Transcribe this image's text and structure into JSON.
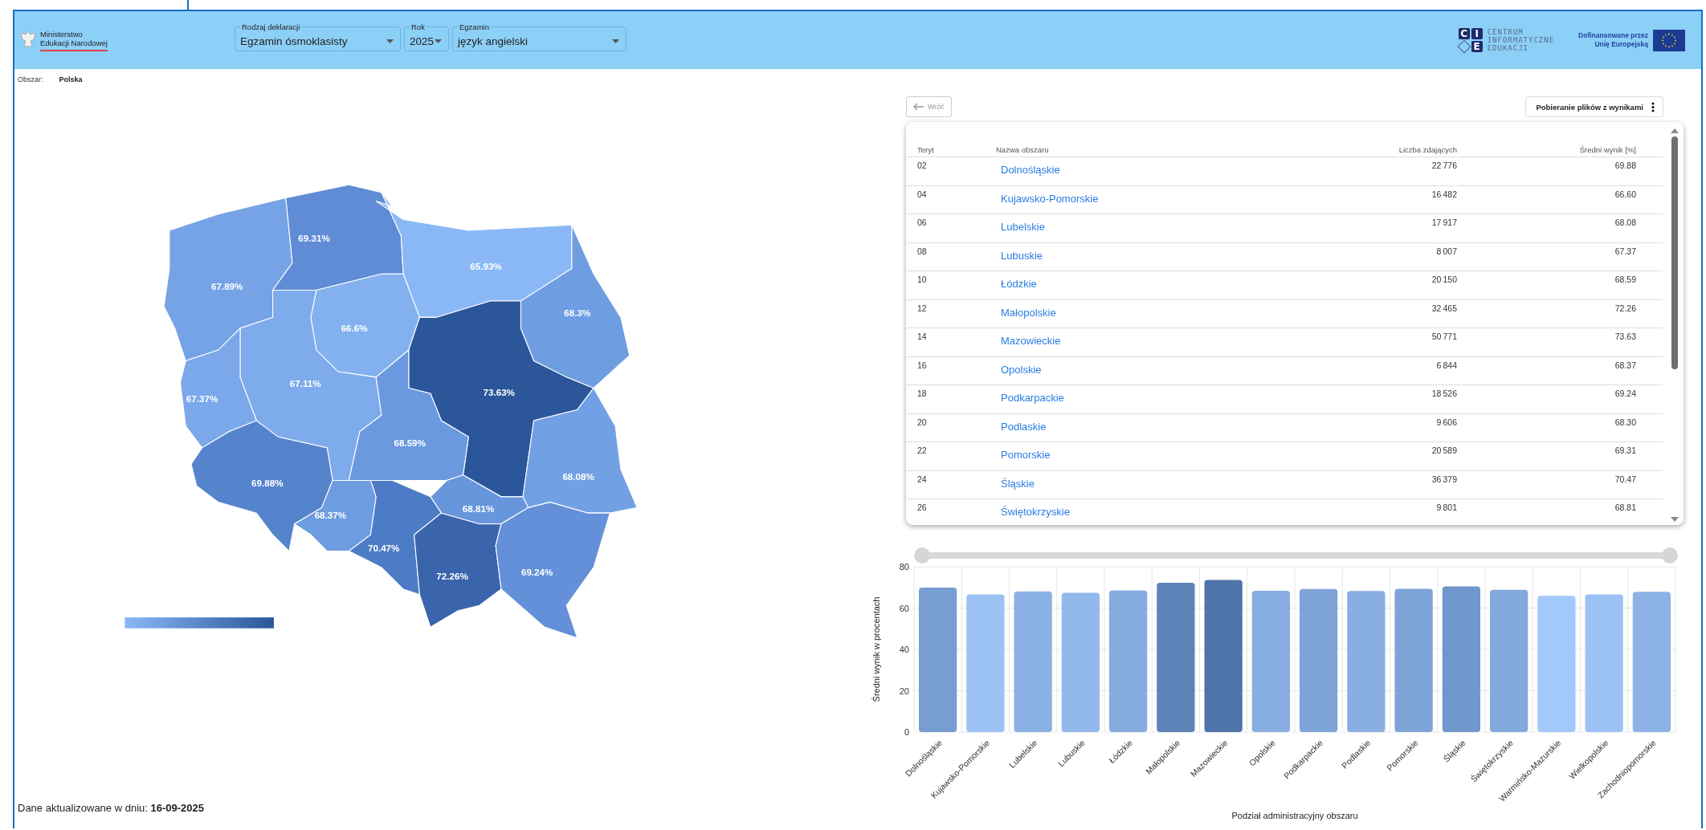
{
  "header": {
    "ministry_name": [
      "Ministerstwo",
      "Edukacji Narodowej"
    ],
    "filters": [
      {
        "label": "Rodzaj deklaracji",
        "value": "Egzamin ósmoklasisty"
      },
      {
        "label": "Rok",
        "value": "2025"
      },
      {
        "label": "Egzamin",
        "value": "język angielski"
      }
    ],
    "cie_logo": {
      "letters": [
        "C",
        "I",
        "E"
      ],
      "lines": [
        "CENTRUM",
        "INFORMATYCZNE",
        "EDUKACJI"
      ]
    },
    "eu_funding": [
      "Dofinansowane przez",
      "Unię Europejską"
    ]
  },
  "area": {
    "label": "Obszar:",
    "value": "Polska"
  },
  "map": {
    "regions": [
      {
        "label": "67.89%",
        "color": "#75a3e6"
      },
      {
        "label": "69.31%",
        "color": "#5f8cd5"
      },
      {
        "label": "65.93%",
        "color": "#8ab8f7"
      },
      {
        "label": "68.3%",
        "color": "#6f9de2"
      },
      {
        "label": "66.6%",
        "color": "#83b1f0"
      },
      {
        "label": "67.11%",
        "color": "#7eabec"
      },
      {
        "label": "67.37%",
        "color": "#7aa8ea"
      },
      {
        "label": "73.63%",
        "color": "#2b569a"
      },
      {
        "label": "68.59%",
        "color": "#6b99df"
      },
      {
        "label": "69.88%",
        "color": "#5584cd"
      },
      {
        "label": "68.37%",
        "color": "#6e9ce1"
      },
      {
        "label": "68.81%",
        "color": "#6896dc"
      },
      {
        "label": "68.08%",
        "color": "#72a0e4"
      },
      {
        "label": "70.47%",
        "color": "#4d7cc6"
      },
      {
        "label": "72.26%",
        "color": "#3a65ad"
      },
      {
        "label": "69.24%",
        "color": "#6390d8"
      }
    ]
  },
  "updated": "Dane aktualizowane w dniu: **16-09-2025**",
  "back_button": {
    "label": "Wróć",
    "disabled": true
  },
  "download_button": {
    "label": "Pobieranie plików z wynikami"
  },
  "table": {
    "columns": [
      "Teryt",
      "Nazwa obszaru",
      "Liczba zdających",
      "Średni wynik [%]"
    ],
    "rows": [
      [
        "02",
        "Dolnośląskie",
        "22 776",
        "69.88"
      ],
      [
        "04",
        "Kujawsko-Pomorskie",
        "16 482",
        "66.60"
      ],
      [
        "06",
        "Lubelskie",
        "17 917",
        "68.08"
      ],
      [
        "08",
        "Lubuskie",
        "8 007",
        "67.37"
      ],
      [
        "10",
        "Łódzkie",
        "20 150",
        "68.59"
      ],
      [
        "12",
        "Małopolskie",
        "32 465",
        "72.26"
      ],
      [
        "14",
        "Mazowieckie",
        "50 771",
        "73.63"
      ],
      [
        "16",
        "Opolskie",
        "6 844",
        "68.37"
      ],
      [
        "18",
        "Podkarpackie",
        "18 526",
        "69.24"
      ],
      [
        "20",
        "Podlaskie",
        "9 606",
        "68.30"
      ],
      [
        "22",
        "Pomorskie",
        "20 589",
        "69.31"
      ],
      [
        "24",
        "Śląskie",
        "36 379",
        "70.47"
      ],
      [
        "26",
        "Świętokrzyskie",
        "9 801",
        "68.81"
      ]
    ]
  },
  "chart": {
    "chart_data": {
      "type": "bar",
      "xlabel": "Podział administracyjny obszaru",
      "ylabel": "Średni wynik w procentach",
      "categories": [
        "Dolnośląskie",
        "Kujawsko-Pomorskie",
        "Lubelskie",
        "Lubuskie",
        "Łódzkie",
        "Małopolskie",
        "Mazowieckie",
        "Opolskie",
        "Podkarpackie",
        "Podlaskie",
        "Pomorskie",
        "Śląskie",
        "Świętokrzyskie",
        "Warmińsko-Mazurskie",
        "Wielkopolskie",
        "Zachodniopomorskie"
      ],
      "series": [
        {
          "values": [
            69.88,
            66.6,
            68.08,
            67.37,
            68.59,
            72.26,
            73.63,
            68.37,
            69.24,
            68.3,
            69.31,
            70.47,
            68.81,
            65.93,
            66.6,
            67.89
          ]
        }
      ],
      "ylim": [
        0,
        80
      ],
      "yticks": [
        0,
        20,
        40,
        60,
        80
      ],
      "grid": true
    }
  },
  "range_slider": {
    "handles": [
      {
        "level": 0
      },
      {
        "level": 1
      }
    ]
  }
}
